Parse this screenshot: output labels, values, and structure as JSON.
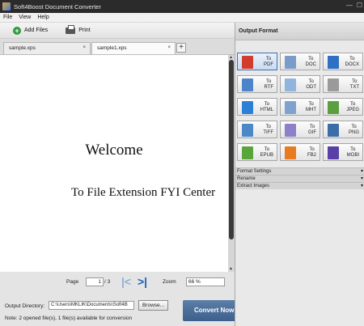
{
  "window": {
    "title": "Soft4Boost Document Converter"
  },
  "menu": {
    "items": [
      "File",
      "View",
      "Help"
    ]
  },
  "toolbar": {
    "add_files": "Add Files",
    "print": "Print"
  },
  "tabs": [
    {
      "label": "sample.xps",
      "close": "×"
    },
    {
      "label": "sample1.xps",
      "close": "×"
    }
  ],
  "document": {
    "heading": "Welcome",
    "subheading": "To File Extension FYI Center"
  },
  "pager": {
    "page_label": "Page",
    "current_page": "1",
    "total": "/ 3",
    "zoom_label": "Zoom",
    "zoom_value": "66 %"
  },
  "output": {
    "dir_label": "Output Directory:",
    "dir_value": "C:\\Users\\MKLIK\\Documents\\Soft4B",
    "browse": "Browse...",
    "note": "Note: 2 opened file(s), 1 file(s) available for conversion",
    "convert": "Convert Now!"
  },
  "right_panel": {
    "header": "Output Format",
    "formats": [
      {
        "to": "To",
        "name": "PDF",
        "icon": "pdf-icon",
        "color": "#d33b2c",
        "selected": true
      },
      {
        "to": "To",
        "name": "DOC",
        "icon": "doc-icon",
        "color": "#7a9cc9",
        "selected": false
      },
      {
        "to": "To",
        "name": "DOCX",
        "icon": "docx-icon",
        "color": "#2f6fc4",
        "selected": false
      },
      {
        "to": "To",
        "name": "RTF",
        "icon": "rtf-icon",
        "color": "#4d84c9",
        "selected": false
      },
      {
        "to": "To",
        "name": "ODT",
        "icon": "odt-icon",
        "color": "#8fb5de",
        "selected": false
      },
      {
        "to": "To",
        "name": "TXT",
        "icon": "txt-icon",
        "color": "#9a9a9a",
        "selected": false
      },
      {
        "to": "To",
        "name": "HTML",
        "icon": "html-icon",
        "color": "#2b7fd6",
        "selected": false
      },
      {
        "to": "To",
        "name": "MHT",
        "icon": "mht-icon",
        "color": "#7fa3cf",
        "selected": false
      },
      {
        "to": "To",
        "name": "JPEG",
        "icon": "jpeg-icon",
        "color": "#5aa040",
        "selected": false
      },
      {
        "to": "To",
        "name": "TIFF",
        "icon": "tiff-icon",
        "color": "#4a88c8",
        "selected": false
      },
      {
        "to": "To",
        "name": "GIF",
        "icon": "gif-icon",
        "color": "#8e7fc9",
        "selected": false
      },
      {
        "to": "To",
        "name": "PNG",
        "icon": "png-icon",
        "color": "#3b6da8",
        "selected": false
      },
      {
        "to": "To",
        "name": "EPUB",
        "icon": "epub-icon",
        "color": "#5aa53a",
        "selected": false
      },
      {
        "to": "To",
        "name": "FB2",
        "icon": "fb2-icon",
        "color": "#e87a1f",
        "selected": false
      },
      {
        "to": "To",
        "name": "MOBI",
        "icon": "mobi-icon",
        "color": "#5a3fa8",
        "selected": false
      }
    ],
    "properties": [
      "Format Settings",
      "Rename",
      "Extract Images"
    ]
  }
}
